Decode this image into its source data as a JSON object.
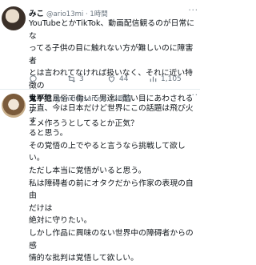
{
  "tweets": [
    {
      "name": "みこ",
      "handle": "@ario13mi",
      "time": "1時間",
      "text": "YouTubeとかTikTok、動画配信観るのが日常にな\nってる子供の目に触れない方が難しいのに障害者\nとは言われてなければ扱いなく、それに近い特徴の\n女が性風俗で働いて男達に酷い目にあわされるア\nニメ作ろうとしてるとか正気？",
      "reply_count": "",
      "retweet_count": "3",
      "like_count": "44",
      "views_count": "1,105"
    },
    {
      "name": "鬼平犯",
      "handle": "@oniheysamrai",
      "time": "2時間",
      "text": "正直、今は日本だけど世界にこの話題は飛び火す\nると思う。\nその覚悟の上でやると言うなら挑戦して欲しい。\nただし本当に覚悟がいると思う。\n私は障碍者の前にオタクだから作家の表現の自由\nだけは\n絶対に守りたい。\nしかし作品に興味のない世界中の障碍者からの感\n情的な批判は覚悟して欲しい。"
    }
  ],
  "icons": {
    "more": "more-dots-icon",
    "reply": "reply-icon",
    "retweet": "retweet-icon",
    "like": "like-icon",
    "views": "views-icon"
  }
}
